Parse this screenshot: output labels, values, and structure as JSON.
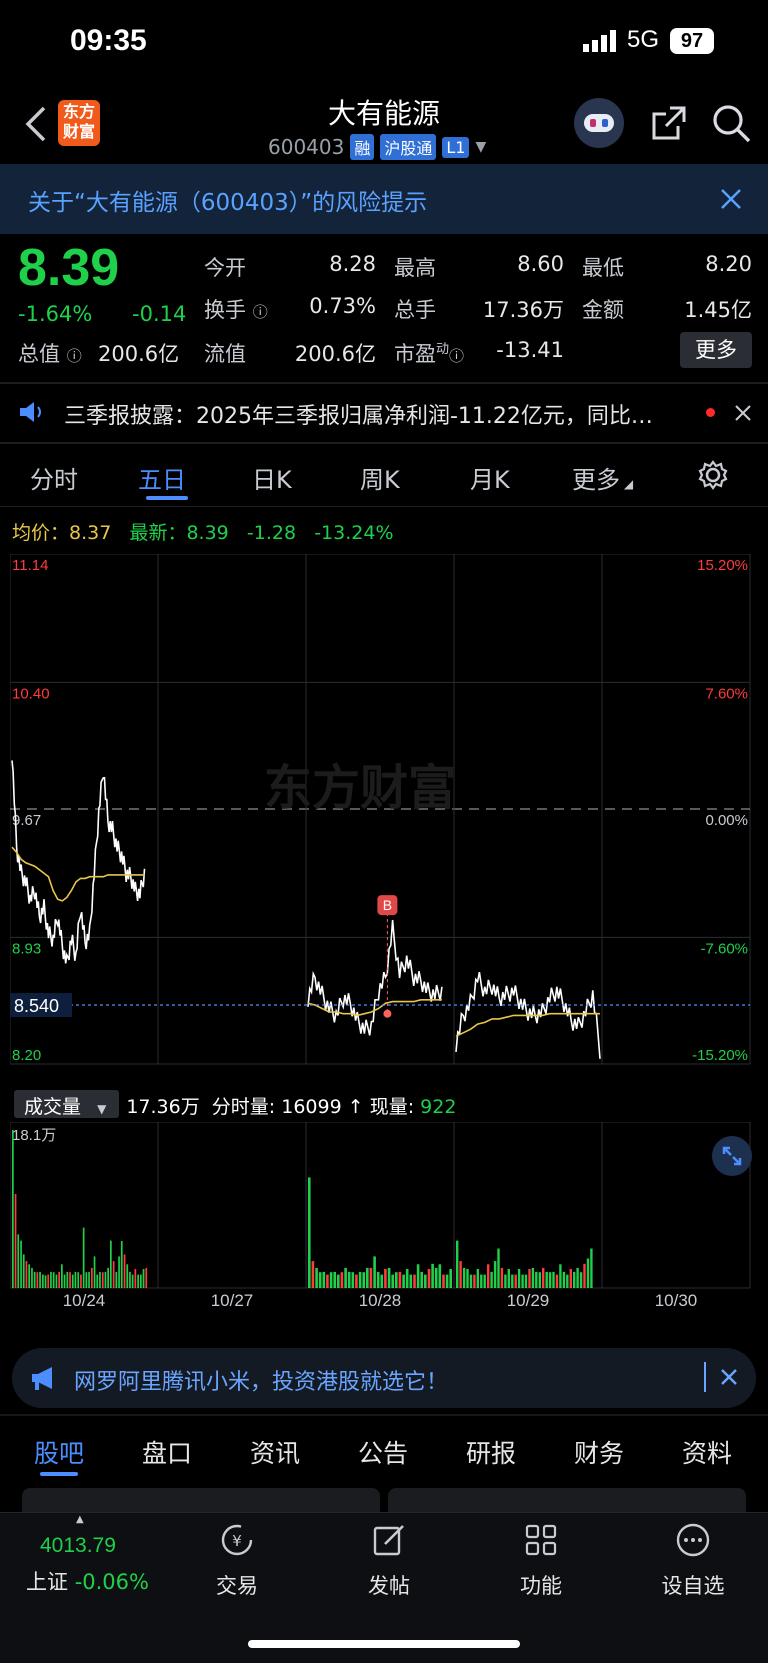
{
  "status": {
    "time": "09:35",
    "network": "5G",
    "battery": "97"
  },
  "header": {
    "title": "大有能源",
    "code": "600403",
    "tags": [
      "融",
      "沪股通",
      "L1"
    ],
    "logo_text": "东方\n财富"
  },
  "risk_banner": {
    "text": "关于“大有能源（600403）”的风险提示"
  },
  "quote": {
    "price": "8.39",
    "change_pct": "-1.64%",
    "change": "-0.14",
    "rows": [
      [
        {
          "label": "今开",
          "value": "8.28",
          "color": "green"
        },
        {
          "label": "最高",
          "value": "8.60",
          "color": "red"
        },
        {
          "label": "最低",
          "value": "8.20",
          "color": "green"
        }
      ],
      [
        {
          "label": "换手",
          "value": "0.73%",
          "color": "white"
        },
        {
          "label": "总手",
          "value": "17.36万",
          "color": "white"
        },
        {
          "label": "金额",
          "value": "1.45亿",
          "color": "white"
        }
      ],
      [
        {
          "label": "总值",
          "value": "200.6亿",
          "color": "white"
        },
        {
          "label": "流值",
          "value": "200.6亿",
          "color": "white"
        },
        {
          "label": "市盈",
          "value": "-13.41",
          "color": "white"
        }
      ]
    ],
    "more_label": "更多"
  },
  "news": {
    "text": "三季报披露：2025年三季报归属净利润-11.22亿元，同比…"
  },
  "chart_tabs": [
    "分时",
    "五日",
    "日K",
    "周K",
    "月K",
    "更多"
  ],
  "active_tab": "五日",
  "legend": {
    "avg_label": "均价：",
    "avg": "8.37",
    "last_label": "最新：",
    "last": "8.39",
    "chg": "-1.28",
    "chg_pct": "-13.24%"
  },
  "chart_data": {
    "type": "line",
    "title": "",
    "y_left_ticks": [
      "11.14",
      "10.40",
      "9.67",
      "8.93",
      "8.20"
    ],
    "y_right_ticks": [
      "15.20%",
      "7.60%",
      "0.00%",
      "-7.60%",
      "-15.20%"
    ],
    "ylim": [
      8.2,
      11.14
    ],
    "prev_close": 9.67,
    "price_marker": "8.540",
    "buy_marker": "B",
    "x_dates": [
      "10/24",
      "10/27",
      "10/28",
      "10/29",
      "10/30"
    ],
    "series": [
      {
        "name": "价",
        "days": [
          [
            10.0,
            9.45,
            9.3,
            9.25,
            9.15,
            9.2,
            9.05,
            9.1,
            8.95,
            8.92,
            9.05,
            8.88,
            8.78,
            8.92,
            8.82,
            9.1,
            8.9,
            8.95,
            9.3,
            9.65,
            9.9,
            9.6,
            9.55,
            9.45,
            9.4,
            9.3,
            9.28,
            9.2,
            9.18,
            9.3
          ],
          [
            8.58,
            8.7,
            8.6,
            8.52,
            8.48,
            8.58,
            8.55,
            8.45,
            8.4,
            8.42,
            8.62,
            8.7,
            8.98,
            8.72,
            8.8,
            8.7,
            8.68,
            8.62,
            8.6,
            8.62
          ],
          [
            8.32,
            8.48,
            8.55,
            8.7,
            8.62,
            8.65,
            8.58,
            8.6,
            8.62,
            8.55,
            8.5,
            8.48,
            8.5,
            8.58,
            8.62,
            8.55,
            8.45,
            8.42,
            8.5,
            8.6,
            8.28
          ]
        ]
      },
      {
        "name": "均价",
        "days": [
          [
            9.45,
            9.42,
            9.38,
            9.36,
            9.35,
            9.34,
            9.32,
            9.3,
            9.28,
            9.2,
            9.15,
            9.14,
            9.16,
            9.2,
            9.25,
            9.27,
            9.27,
            9.28,
            9.28,
            9.28,
            9.28,
            9.29,
            9.29,
            9.29,
            9.29,
            9.29,
            9.29,
            9.29,
            9.29,
            9.29
          ],
          [
            8.55,
            8.54,
            8.52,
            8.5,
            8.5,
            8.49,
            8.49,
            8.48,
            8.49,
            8.5,
            8.52,
            8.55,
            8.56,
            8.56,
            8.56,
            8.56,
            8.57,
            8.57,
            8.57,
            8.57
          ],
          [
            8.36,
            8.38,
            8.4,
            8.43,
            8.44,
            8.46,
            8.46,
            8.47,
            8.48,
            8.48,
            8.48,
            8.48,
            8.48,
            8.49,
            8.49,
            8.49,
            8.49,
            8.49,
            8.49,
            8.49,
            8.49
          ]
        ]
      }
    ]
  },
  "volume": {
    "label": "成交量",
    "total": "17.36万",
    "split_label": "分时量:",
    "split": "16099",
    "now_label": "现量:",
    "now": "922",
    "max": "18.1万",
    "bars": [
      [
        1,
        0.7,
        0.4,
        0.3,
        0.25,
        0.2,
        0.15,
        0.15,
        0.12,
        0.1,
        0.12,
        0.1,
        0.08,
        0.1,
        0.12,
        0.1,
        0.1,
        0.12,
        0.15,
        0.1,
        0.12,
        0.1,
        0.1,
        0.12,
        0.1,
        0.1,
        0.45,
        0.1,
        0.12,
        0.15,
        0.2,
        0.1,
        0.12,
        0.1,
        0.12,
        0.15,
        0.3,
        0.2,
        0.12,
        0.2,
        0.35,
        0.25,
        0.15,
        0.12,
        0.1,
        0.12,
        0.1,
        0.1,
        0.12,
        0.15
      ],
      [
        0.7,
        0.2,
        0.15,
        0.1,
        0.12,
        0.1,
        0.1,
        0.12,
        0.1,
        0.1,
        0.15,
        0.12,
        0.1,
        0.1,
        0.12,
        0.1,
        0.15,
        0.15,
        0.2,
        0.12,
        0.1,
        0.12,
        0.15,
        0.1,
        0.1,
        0.12,
        0.1,
        0.12,
        0.1,
        0.1,
        0.15,
        0.12,
        0.1,
        0.12,
        0.18,
        0.15,
        0.15,
        0.1,
        0.1,
        0.12
      ],
      [
        0.3,
        0.2,
        0.15,
        0.12,
        0.1,
        0.1,
        0.12,
        0.1,
        0.1,
        0.15,
        0.12,
        0.2,
        0.25,
        0.15,
        0.1,
        0.12,
        0.1,
        0.1,
        0.12,
        0.1,
        0.1,
        0.12,
        0.15,
        0.12,
        0.1,
        0.15,
        0.12,
        0.1,
        0.12,
        0.1,
        0.15,
        0.12,
        0.1,
        0.12,
        0.12,
        0.15,
        0.1,
        0.18,
        0.22,
        0.25
      ]
    ]
  },
  "ad": {
    "text": "网罗阿里腾讯小米，投资港股就选它！"
  },
  "bottom_tabs": [
    "股吧",
    "盘口",
    "资讯",
    "公告",
    "研报",
    "财务",
    "资料"
  ],
  "nav": {
    "index_value": "4013.79",
    "index_name": "上证",
    "index_chg": "-0.06%",
    "items": [
      "交易",
      "发帖",
      "功能",
      "设自选"
    ]
  }
}
